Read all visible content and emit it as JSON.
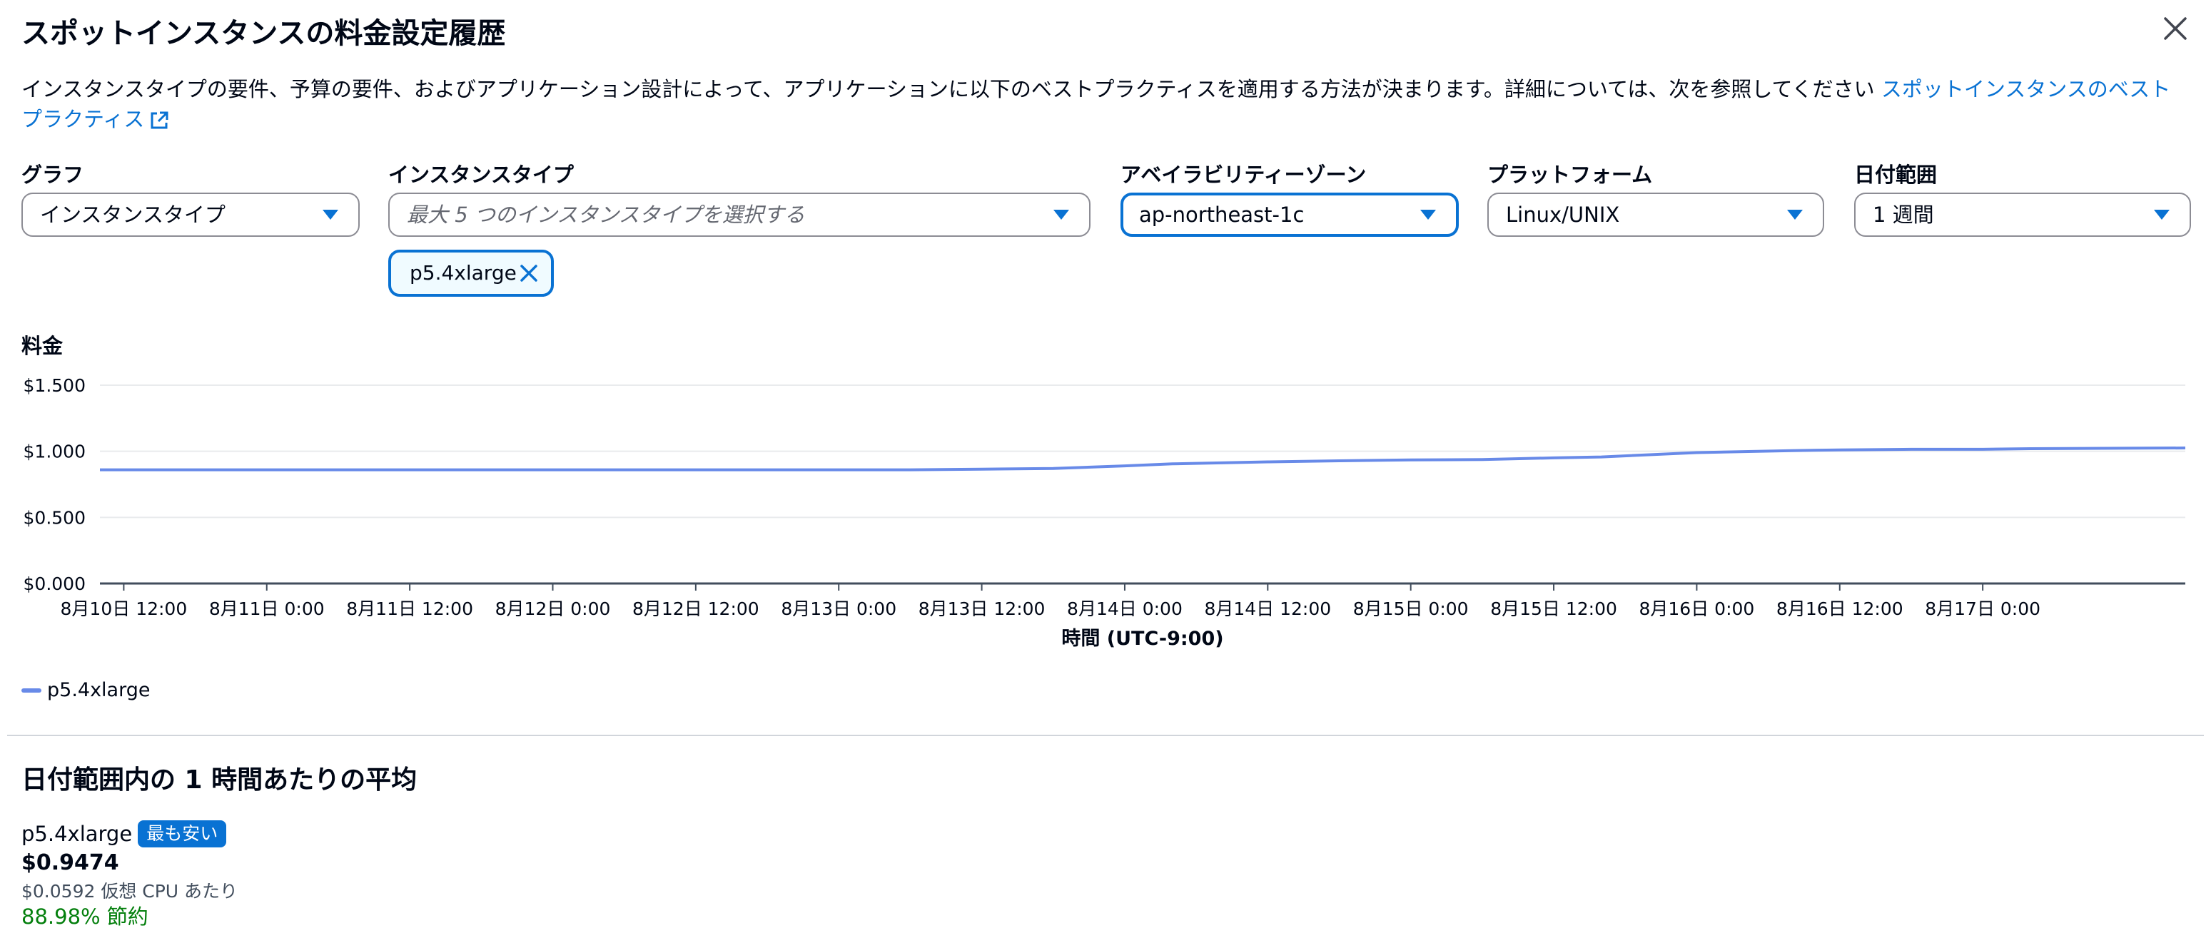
{
  "modal": {
    "title": "スポットインスタンスの料金設定履歴",
    "description": "インスタンスタイプの要件、予算の要件、およびアプリケーション設計によって、アプリケーションに以下のベストプラクティスを適用する方法が決まります。詳細については、次を参照してください",
    "link_text": "スポットインスタンスのベストプラクティス",
    "close_icon": "close-icon",
    "external_icon": "external-link-icon"
  },
  "filters": {
    "graph": {
      "label": "グラフ",
      "value": "インスタンスタイプ"
    },
    "instance_type": {
      "label": "インスタンスタイプ",
      "placeholder": "最大 5 つのインスタンスタイプを選択する",
      "tokens": [
        "p5.4xlarge"
      ]
    },
    "availability_zone": {
      "label": "アベイラビリティーゾーン",
      "value": "ap-northeast-1c"
    },
    "platform": {
      "label": "プラットフォーム",
      "value": "Linux/UNIX"
    },
    "date_range": {
      "label": "日付範囲",
      "value": "1 週間"
    }
  },
  "chart_title": "料金",
  "chart_data": {
    "type": "line",
    "xlabel": "時間 (UTC-9:00)",
    "ylabel": "料金",
    "ylim": [
      0,
      1.5
    ],
    "y_ticks": [
      "$0.000",
      "$0.500",
      "$1.000",
      "$1.500"
    ],
    "y_tick_values": [
      0,
      0.5,
      1.0,
      1.5
    ],
    "x_ticks": [
      "8月10日 12:00",
      "8月11日 0:00",
      "8月11日 12:00",
      "8月12日 0:00",
      "8月12日 12:00",
      "8月13日 0:00",
      "8月13日 12:00",
      "8月14日 0:00",
      "8月14日 12:00",
      "8月15日 0:00",
      "8月15日 12:00",
      "8月16日 0:00",
      "8月16日 12:00",
      "8月17日 0:00"
    ],
    "x_tick_hours": [
      0,
      12,
      24,
      36,
      48,
      60,
      72,
      84,
      96,
      108,
      120,
      132,
      144,
      156
    ],
    "xlim_hours": [
      -2,
      173
    ],
    "grid": true,
    "legend_position": "bottom-left",
    "series": [
      {
        "name": "p5.4xlarge",
        "color": "#688ae8",
        "x_hours": [
          -2,
          12,
          24,
          36,
          48,
          60,
          66,
          72,
          78,
          84,
          88,
          96,
          102,
          108,
          114,
          120,
          124,
          132,
          140,
          144,
          150,
          156,
          160,
          173
        ],
        "values": [
          0.86,
          0.86,
          0.86,
          0.86,
          0.86,
          0.86,
          0.86,
          0.865,
          0.87,
          0.89,
          0.905,
          0.92,
          0.928,
          0.935,
          0.937,
          0.95,
          0.957,
          0.99,
          1.005,
          1.01,
          1.015,
          1.015,
          1.02,
          1.025
        ]
      }
    ]
  },
  "legend": {
    "items": [
      {
        "label": "p5.4xlarge",
        "color": "#688ae8"
      }
    ]
  },
  "summary": {
    "title": "日付範囲内の 1 時間あたりの平均",
    "instance": "p5.4xlarge",
    "badge": "最も安い",
    "price": "$0.9474",
    "per_cpu": "$0.0592 仮想 CPU あたり",
    "savings": "88.98% 節約"
  }
}
